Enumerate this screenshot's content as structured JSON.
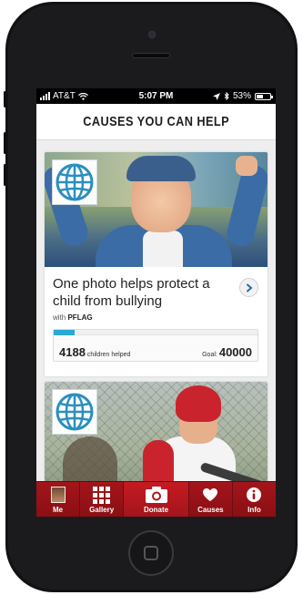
{
  "status_bar": {
    "carrier": "AT&T",
    "time": "5:07 PM",
    "battery": "53%",
    "battery_level": 0.53
  },
  "header": {
    "title": "CAUSES YOU CAN HELP"
  },
  "causes": [
    {
      "headline": "One photo helps protect a child from bullying",
      "with_label": "with",
      "partner": "PFLAG",
      "helped_count": "4188",
      "helped_label": "children helped",
      "goal_label": "Goal:",
      "goal_value": "40000",
      "progress": 0.1047,
      "icon": "globe-icon",
      "photo": "smiling-child-photo"
    },
    {
      "icon": "globe-icon",
      "photo": "baseball-child-photo"
    }
  ],
  "tabbar": {
    "items": [
      {
        "label": "Me",
        "icon": "avatar-icon"
      },
      {
        "label": "Gallery",
        "icon": "grid-icon"
      },
      {
        "label": "Donate",
        "icon": "camera-icon"
      },
      {
        "label": "Causes",
        "icon": "heart-icon"
      },
      {
        "label": "Info",
        "icon": "info-icon"
      }
    ]
  },
  "colors": {
    "brand_red": "#a3151b",
    "progress_blue": "#29a9d6",
    "globe_blue": "#2a8fbf"
  }
}
